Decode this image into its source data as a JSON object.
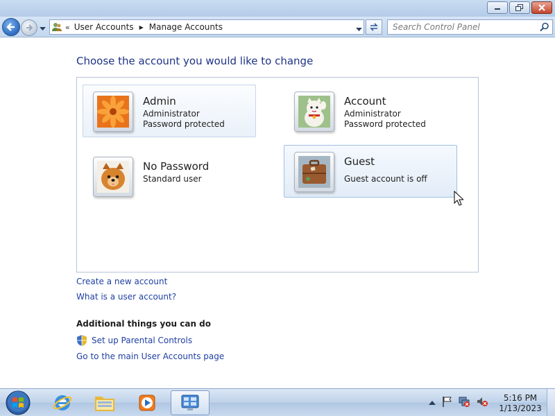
{
  "window": {
    "controls": {
      "minimize": "minimize",
      "maximize": "restore",
      "close": "close"
    }
  },
  "nav": {
    "breadcrumb": [
      "User Accounts",
      "Manage Accounts"
    ],
    "search_placeholder": "Search Control Panel"
  },
  "main": {
    "heading": "Choose the account you would like to change",
    "accounts": [
      {
        "name": "Admin",
        "type": "Administrator",
        "status": "Password protected",
        "picture": "orange-flower"
      },
      {
        "name": "Account",
        "type": "Administrator",
        "status": "Password protected",
        "picture": "lucky-cat"
      },
      {
        "name": "No Password",
        "type": "Standard user",
        "status": "",
        "picture": "puppy"
      },
      {
        "name": "Guest",
        "type": "Guest account is off",
        "status": "",
        "picture": "suitcase"
      }
    ],
    "links": {
      "create": "Create a new account",
      "what_is": "What is a user account?"
    },
    "additional": {
      "title": "Additional things you can do",
      "parental": "Set up Parental Controls",
      "main_page": "Go to the main User Accounts page"
    }
  },
  "taskbar": {
    "apps": [
      "internet-explorer",
      "windows-explorer",
      "media-player",
      "control-panel"
    ],
    "clock": {
      "time": "5:16 PM",
      "date": "1/13/2023"
    }
  },
  "colors": {
    "heading": "#1e3287",
    "link": "#1f3fa3"
  }
}
